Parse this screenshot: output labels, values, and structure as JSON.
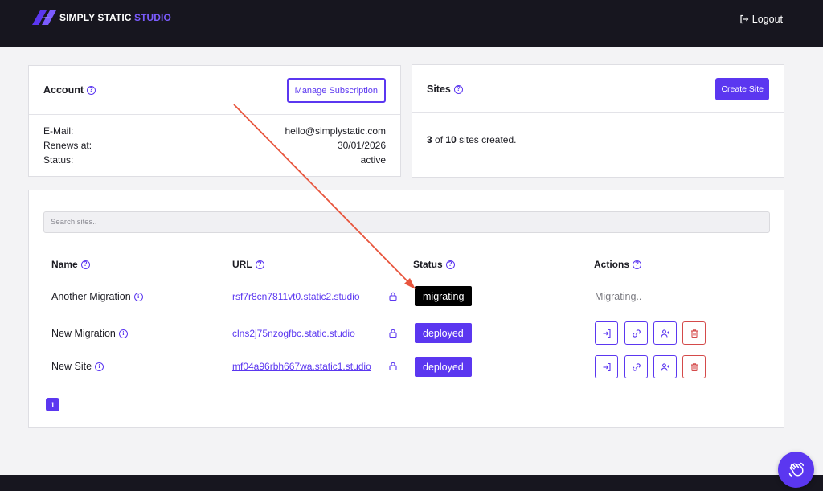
{
  "brand": {
    "name_main": "SIMPLY STATIC",
    "name_accent": "STUDIO",
    "accent_color": "#5b37f0",
    "dark_color": "#17161f"
  },
  "header": {
    "logout_label": "Logout"
  },
  "account": {
    "title": "Account",
    "manage_label": "Manage Subscription",
    "rows": [
      {
        "label": "E-Mail:",
        "value": "hello@simplystatic.com"
      },
      {
        "label": "Renews at:",
        "value": "30/01/2026"
      },
      {
        "label": "Status:",
        "value": "active"
      }
    ]
  },
  "sites": {
    "title": "Sites",
    "create_label": "Create Site",
    "created": "3",
    "limit": "10",
    "created_of": "of",
    "created_suffix": "sites created."
  },
  "table": {
    "search_placeholder": "Search sites..",
    "columns": {
      "name": "Name",
      "url": "URL",
      "status": "Status",
      "actions": "Actions"
    },
    "rows": [
      {
        "name": "Another Migration",
        "url": "rsf7r8cn7811vt0.static2.studio",
        "status": "migrating",
        "actions_text": "Migrating.."
      },
      {
        "name": "New Migration",
        "url": "clns2j75nzogfbc.static.studio",
        "status": "deployed",
        "actions_text": ""
      },
      {
        "name": "New Site",
        "url": "mf04a96rbh667wa.static1.studio",
        "status": "deployed",
        "actions_text": ""
      }
    ],
    "current_page": "1"
  },
  "icons": {
    "login": "login-icon",
    "link": "link-icon",
    "add_user": "user-plus-icon",
    "delete": "trash-icon",
    "lock": "lock-icon",
    "help": "hand-wave-icon"
  },
  "annotation": {
    "arrow_color": "#e8553d"
  }
}
